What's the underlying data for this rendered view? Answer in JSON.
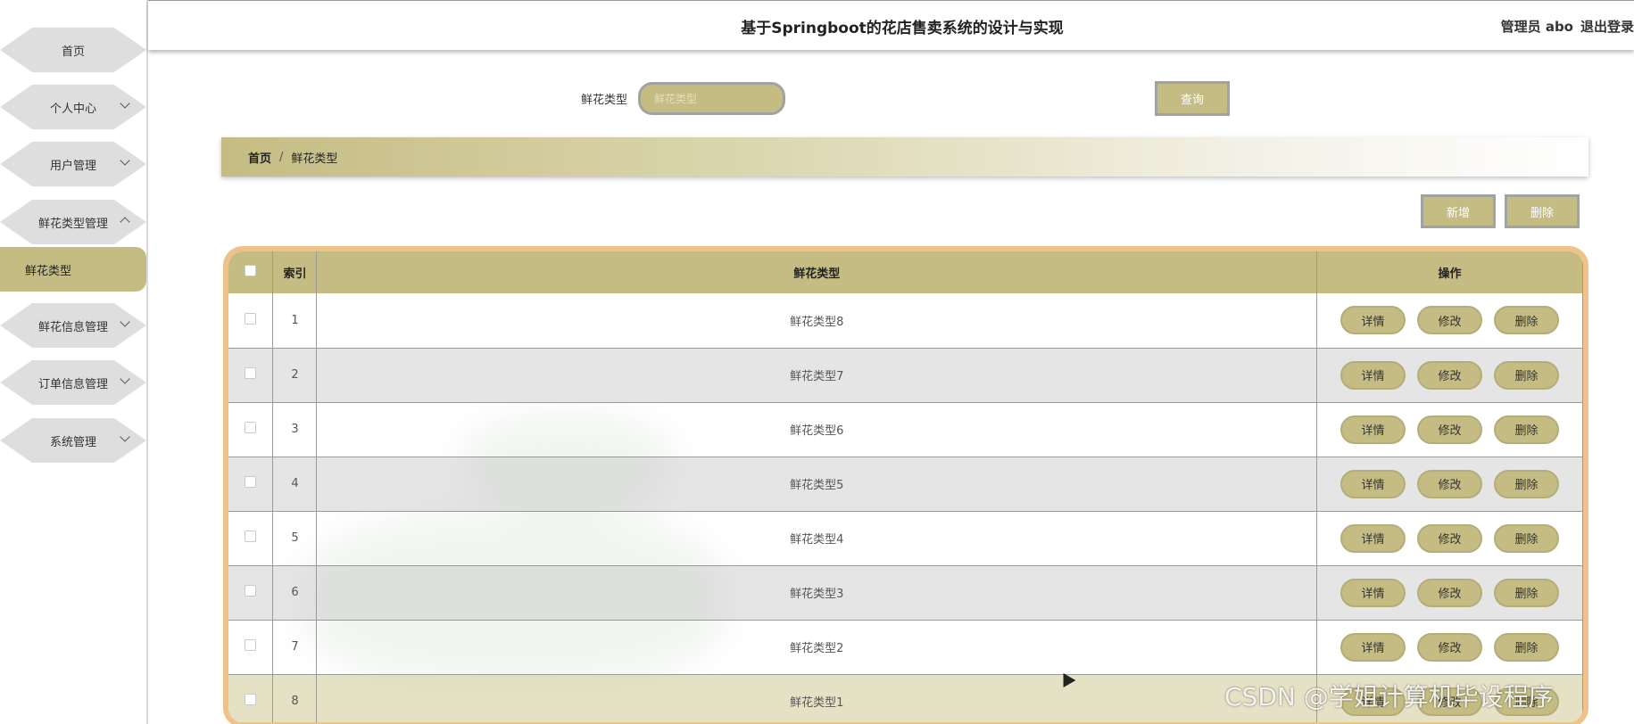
{
  "header": {
    "title": "基于Springboot的花店售卖系统的设计与实现",
    "user": "管理员 abo",
    "logout": "退出登录"
  },
  "sidebar": {
    "items": [
      {
        "label": "首页"
      },
      {
        "label": "个人中心"
      },
      {
        "label": "用户管理"
      },
      {
        "label": "鲜花类型管理"
      },
      {
        "label": "鲜花信息管理"
      },
      {
        "label": "订单信息管理"
      },
      {
        "label": "系统管理"
      }
    ],
    "active_sub": "鲜花类型"
  },
  "search": {
    "label": "鲜花类型",
    "placeholder": "鲜花类型",
    "button": "查询"
  },
  "breadcrumb": {
    "home": "首页",
    "separator": "/",
    "current": "鲜花类型"
  },
  "actions": {
    "add": "新增",
    "delete": "删除"
  },
  "table": {
    "columns": [
      "索引",
      "鲜花类型",
      "操作"
    ],
    "rows": [
      {
        "index": "1",
        "type": "鲜花类型8"
      },
      {
        "index": "2",
        "type": "鲜花类型7"
      },
      {
        "index": "3",
        "type": "鲜花类型6"
      },
      {
        "index": "4",
        "type": "鲜花类型5"
      },
      {
        "index": "5",
        "type": "鲜花类型4"
      },
      {
        "index": "6",
        "type": "鲜花类型3"
      },
      {
        "index": "7",
        "type": "鲜花类型2"
      },
      {
        "index": "8",
        "type": "鲜花类型1"
      }
    ],
    "row_actions": {
      "detail": "详情",
      "edit": "修改",
      "delete": "删除"
    }
  },
  "watermark": "CSDN @学姐计算机毕设程序",
  "colors": {
    "accent": "#c4bc82",
    "frame": "#efc288",
    "row_alt": "#e0e0e0"
  }
}
